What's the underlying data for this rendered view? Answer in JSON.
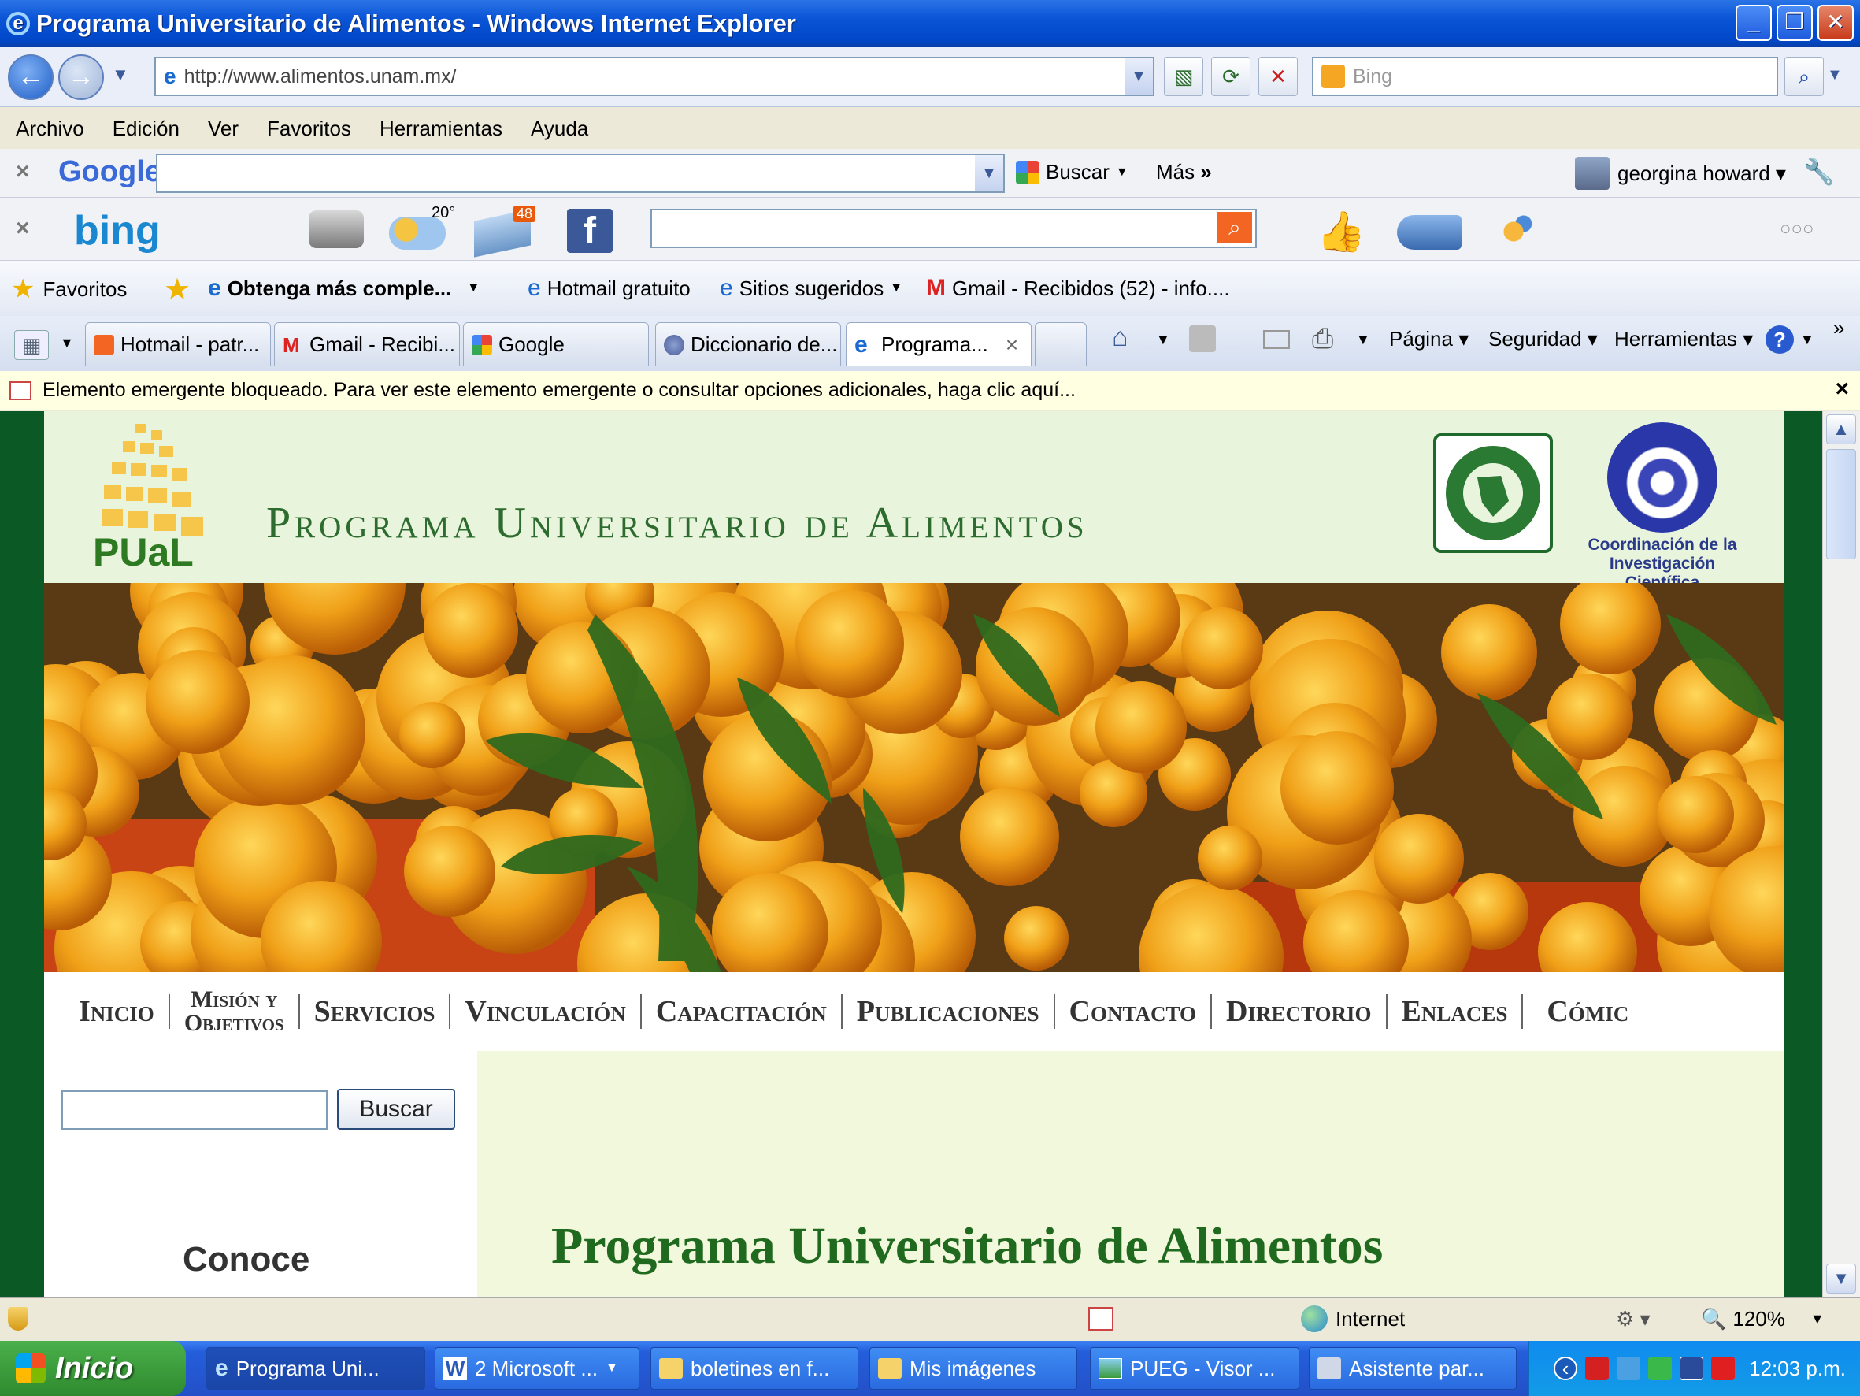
{
  "window": {
    "title": "Programa Universitario de Alimentos - Windows Internet Explorer"
  },
  "address": {
    "url": "http://www.alimentos.unam.mx/",
    "search_placeholder": "Bing"
  },
  "menu": [
    "Archivo",
    "Edición",
    "Ver",
    "Favoritos",
    "Herramientas",
    "Ayuda"
  ],
  "google_toolbar": {
    "logo": "Google",
    "search_label": "Buscar",
    "more_label": "Más",
    "user": "georgina howard"
  },
  "bing_toolbar": {
    "logo": "bing",
    "weather_temp": "20°",
    "mail_count": "48"
  },
  "favorites": {
    "label": "Favoritos",
    "items": [
      "Obtenga más comple...",
      "Hotmail gratuito",
      "Sitios sugeridos",
      "Gmail - Recibidos (52) - info...."
    ]
  },
  "tabs": [
    "Hotmail - patr...",
    "Gmail - Recibi...",
    "Google",
    "Diccionario de...",
    "Programa..."
  ],
  "command_bar": {
    "page": "Página",
    "security": "Seguridad",
    "tools": "Herramientas"
  },
  "popup_notice": "Elemento emergente bloqueado. Para ver este elemento emergente o consultar opciones adicionales, haga clic aquí...",
  "site": {
    "banner_title": "Programa Universitario de Alimentos",
    "pual_logo_text": "PUaL",
    "cic_text": [
      "Coordinación de la",
      "Investigación Científica"
    ],
    "nav": [
      "Inicio",
      "Misión y",
      "Objetivos",
      "Servicios",
      "Vinculación",
      "Capacitación",
      "Publicaciones",
      "Contacto",
      "Directorio",
      "Enlaces",
      "Cómic"
    ],
    "search_button": "Buscar",
    "conoce": "Conoce",
    "heading": "Programa Universitario de Alimentos"
  },
  "status": {
    "zone": "Internet",
    "zoom": "120%"
  },
  "taskbar": {
    "start": "Inicio",
    "tasks": [
      "Programa Uni...",
      "2 Microsoft ...",
      "boletines en f...",
      "Mis imágenes",
      "PUEG - Visor ...",
      "Asistente par..."
    ],
    "clock": "12:03 p.m."
  },
  "colors": {
    "site_green": "#0b5a26",
    "header_bg": "#e9f4dc",
    "title_green": "#1f6a1f"
  }
}
